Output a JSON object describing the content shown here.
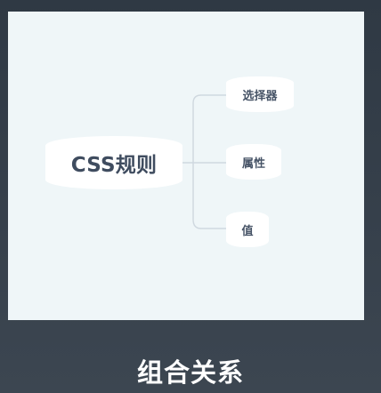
{
  "diagram": {
    "root": {
      "label": "CSS规则"
    },
    "children": [
      {
        "label": "选择器"
      },
      {
        "label": "属性"
      },
      {
        "label": "值"
      }
    ]
  },
  "caption": "组合关系",
  "colors": {
    "background": "#353f4a",
    "canvas": "#eff6f8",
    "node": "#ffffff",
    "text": "#465466",
    "line": "#cfd8df"
  }
}
